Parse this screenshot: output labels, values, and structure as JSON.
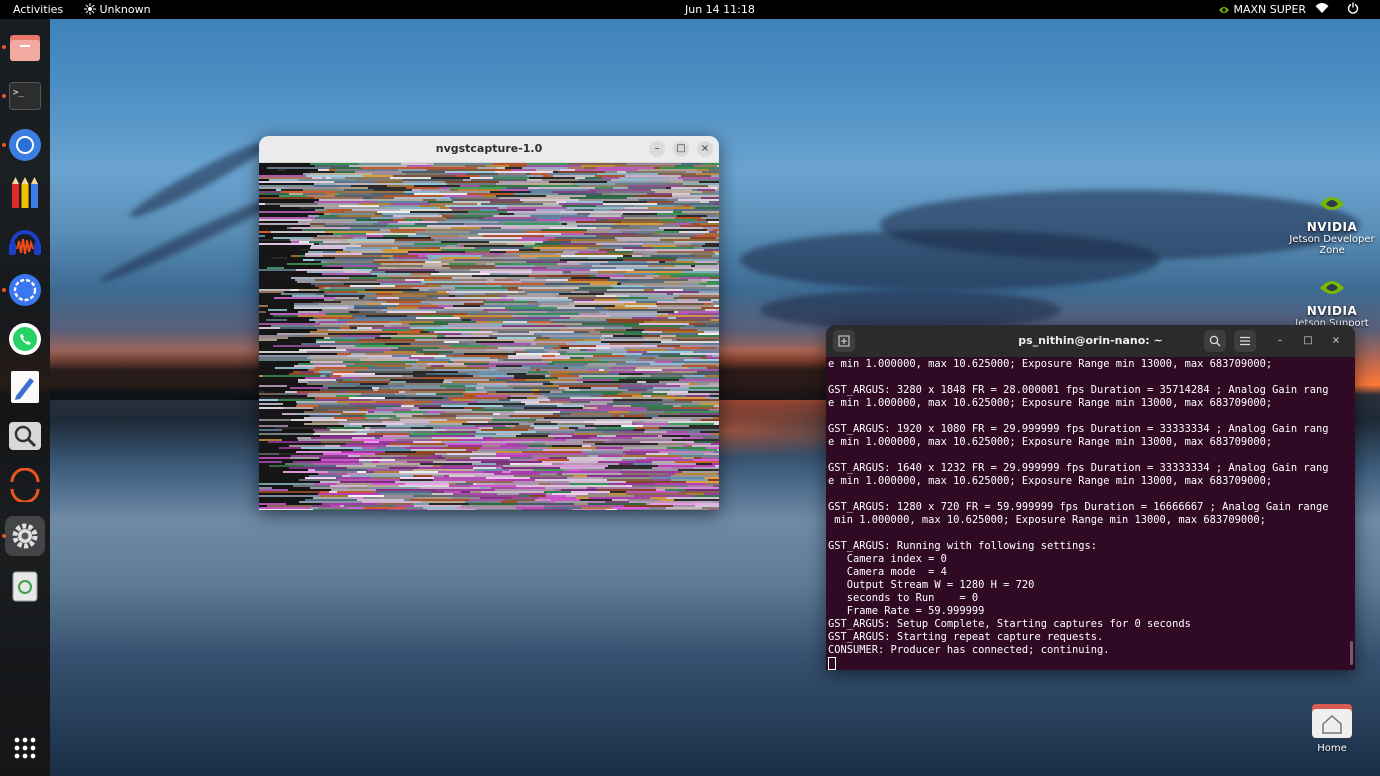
{
  "topbar": {
    "activities": "Activities",
    "app_name": "Unknown",
    "datetime": "Jun 14  11:18",
    "power_mode": "MAXN SUPER"
  },
  "dock": {
    "items": [
      {
        "name": "files",
        "icon": "files-icon"
      },
      {
        "name": "terminal",
        "icon": "terminal-icon"
      },
      {
        "name": "chromium",
        "icon": "chromium-icon"
      },
      {
        "name": "pencils",
        "icon": "pencils-icon"
      },
      {
        "name": "audacity",
        "icon": "audacity-icon"
      },
      {
        "name": "signal",
        "icon": "signal-icon"
      },
      {
        "name": "whatsapp",
        "icon": "whatsapp-icon"
      },
      {
        "name": "text-editor",
        "icon": "text-editor-icon"
      },
      {
        "name": "search",
        "icon": "search-icon"
      },
      {
        "name": "ubuntu-installer",
        "icon": "ubuntu-icon"
      },
      {
        "name": "settings",
        "icon": "gear-icon"
      },
      {
        "name": "trash",
        "icon": "trash-icon"
      }
    ],
    "apps_grid_icon": "apps-grid-icon"
  },
  "capture_window": {
    "title": "nvgstcapture-1.0",
    "minimize": "–",
    "maximize": "□",
    "close": "×"
  },
  "terminal": {
    "title": "ps_nithin@orin-nano: ~",
    "lines": [
      "e min 1.000000, max 10.625000; Exposure Range min 13000, max 683709000;",
      "",
      "GST_ARGUS: 3280 x 1848 FR = 28.000001 fps Duration = 35714284 ; Analog Gain rang",
      "e min 1.000000, max 10.625000; Exposure Range min 13000, max 683709000;",
      "",
      "GST_ARGUS: 1920 x 1080 FR = 29.999999 fps Duration = 33333334 ; Analog Gain rang",
      "e min 1.000000, max 10.625000; Exposure Range min 13000, max 683709000;",
      "",
      "GST_ARGUS: 1640 x 1232 FR = 29.999999 fps Duration = 33333334 ; Analog Gain rang",
      "e min 1.000000, max 10.625000; Exposure Range min 13000, max 683709000;",
      "",
      "GST_ARGUS: 1280 x 720 FR = 59.999999 fps Duration = 16666667 ; Analog Gain range",
      " min 1.000000, max 10.625000; Exposure Range min 13000, max 683709000;",
      "",
      "GST_ARGUS: Running with following settings:",
      "   Camera index = 0",
      "   Camera mode  = 4",
      "   Output Stream W = 1280 H = 720",
      "   seconds to Run    = 0",
      "   Frame Rate = 59.999999",
      "GST_ARGUS: Setup Complete, Starting captures for 0 seconds",
      "GST_ARGUS: Starting repeat capture requests.",
      "CONSUMER: Producer has connected; continuing."
    ]
  },
  "desktop": {
    "icons": [
      {
        "logo": "NVIDIA",
        "label": "Jetson Developer Zone"
      },
      {
        "logo": "NVIDIA",
        "label": "Jetson Support"
      },
      {
        "label": "Home"
      }
    ]
  },
  "colors": {
    "terminal_bg": "#300a24",
    "accent": "#e95420",
    "nvidia_green": "#76b900"
  }
}
